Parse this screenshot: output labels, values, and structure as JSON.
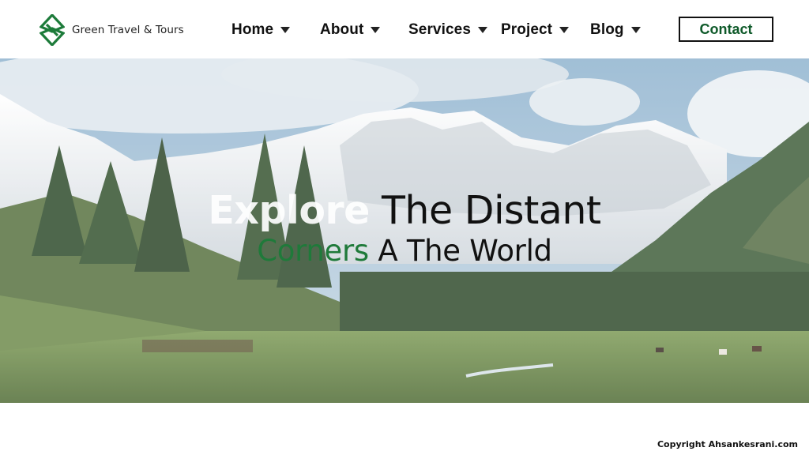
{
  "brand": {
    "name": "Green Travel & Tours",
    "logo_icon": "green-diamond-s-logo-icon",
    "color": "#1d7b3a"
  },
  "nav": {
    "items": [
      {
        "label": "Home",
        "icon": "caret-down-icon"
      },
      {
        "label": "About",
        "icon": "caret-down-icon"
      },
      {
        "label": "Services",
        "icon": "caret-down-icon"
      },
      {
        "label": "Project",
        "icon": "caret-down-icon"
      },
      {
        "label": "Blog",
        "icon": "caret-down-icon"
      }
    ],
    "contact_label": "Contact"
  },
  "hero": {
    "headline_line1_highlight": "Explore",
    "headline_line1_rest": " The Distant",
    "headline_line2_highlight": "Corners",
    "headline_line2_rest": " A The World",
    "accent_color": "#1f7a3a"
  },
  "footer": {
    "copyright": "Copyright Ahsankesrani.com"
  }
}
